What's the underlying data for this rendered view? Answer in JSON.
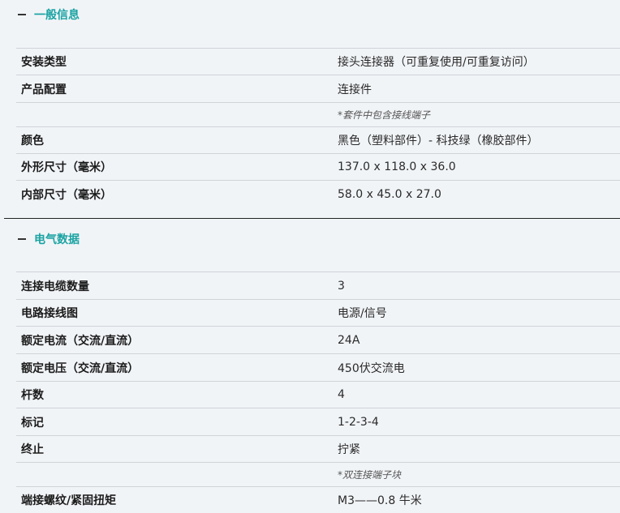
{
  "sections": [
    {
      "title": "一般信息",
      "rows": [
        {
          "label": "安装类型",
          "value": "接头连接器（可重复使用/可重复访问）"
        },
        {
          "label": "产品配置",
          "value": "连接件"
        },
        {
          "label": "",
          "value": "*套件中包含接线端子"
        },
        {
          "label": "颜色",
          "value": "黑色（塑料部件）- 科技绿（橡胶部件）"
        },
        {
          "label": "外形尺寸（毫米）",
          "value": "137.0 x 118.0 x 36.0"
        },
        {
          "label": "内部尺寸（毫米）",
          "value": "58.0 x 45.0 x 27.0"
        }
      ]
    },
    {
      "title": "电气数据",
      "rows": [
        {
          "label": "连接电缆数量",
          "value": "3"
        },
        {
          "label": "电路接线图",
          "value": "电源/信号"
        },
        {
          "label": "额定电流（交流/直流）",
          "value": "24A"
        },
        {
          "label": "额定电压（交流/直流）",
          "value": "450伏交流电"
        },
        {
          "label": "杆数",
          "value": "4"
        },
        {
          "label": "标记",
          "value": "1-2-3-4"
        },
        {
          "label": "终止",
          "value": "拧紧"
        },
        {
          "label": "",
          "value": "*双连接端子块"
        },
        {
          "label": "端接螺纹/紧固扭矩",
          "value": "M3——0.8 牛米"
        }
      ]
    }
  ]
}
